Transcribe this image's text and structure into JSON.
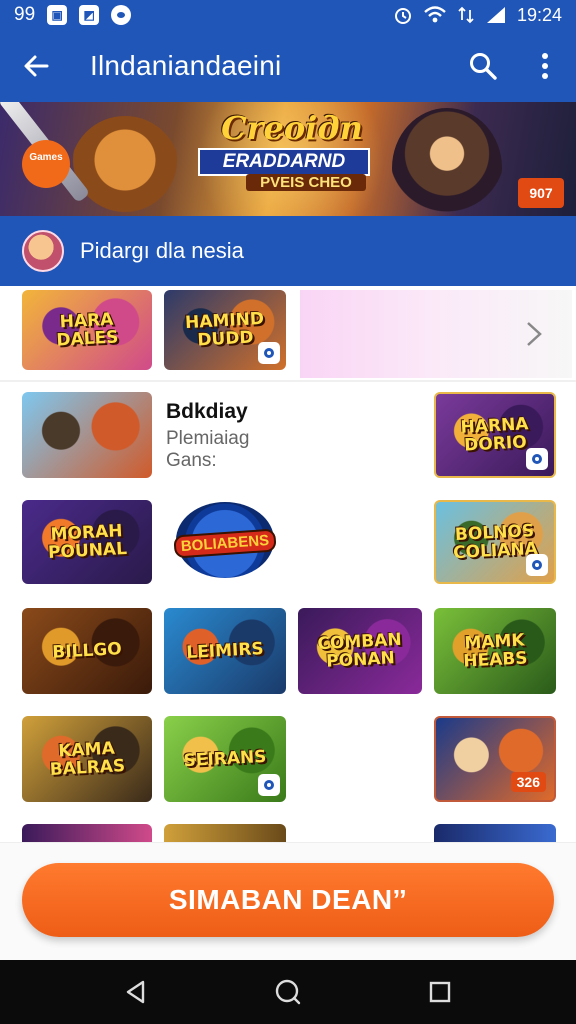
{
  "status_bar": {
    "left_text": "99",
    "time": "19:24",
    "icons": [
      "notification-icon",
      "image-icon",
      "record-icon"
    ],
    "right_icons": [
      "alarm-icon",
      "wifi-icon",
      "data-icon",
      "signal-icon",
      "battery-icon"
    ]
  },
  "app_bar": {
    "title": "Ilndaniandaeini",
    "back_icon": "arrow-left-icon",
    "search_icon": "search-icon",
    "more_icon": "more-vertical-icon"
  },
  "banner": {
    "title": "Crеоiдn",
    "subtitle": "ERADDARND",
    "tagline": "PVEIS CHEO",
    "left_badge": "Games",
    "right_badge": "907"
  },
  "section": {
    "title": "Pidargı dla nesia"
  },
  "tiles": [
    {
      "label": "HARA\nDALES",
      "colors": [
        "#f2b53a",
        "#d04a8a",
        "#7a2a8a"
      ]
    },
    {
      "label": "HAMIND\nDUDD",
      "colors": [
        "#2c3a6a",
        "#d0702a",
        "#1a2a4a"
      ]
    },
    {
      "label": "",
      "colors": [
        "#7ec8f0",
        "#d05a2a",
        "#4a3a2a"
      ]
    },
    {
      "label": "HARNA\nDORIO",
      "colors": [
        "#7a3a9a",
        "#3a1a5a",
        "#f0b03a"
      ]
    },
    {
      "label": "MORAH\nPOUNAL",
      "colors": [
        "#4a2a8a",
        "#2a1a4a",
        "#f07a2a"
      ]
    },
    {
      "label": "BOLNOS\nCOLIANA",
      "colors": [
        "#6ac0e0",
        "#e0a04a",
        "#3a6a2a"
      ]
    },
    {
      "label": "BILLGO",
      "colors": [
        "#8a4a1a",
        "#3a1a0a",
        "#e09a2a"
      ]
    },
    {
      "label": "LEIMIRS",
      "colors": [
        "#2a8ad0",
        "#1a3a6a",
        "#e0602a"
      ]
    },
    {
      "label": "COMBAN\nPONAN",
      "colors": [
        "#3a1a5a",
        "#8a2a9a",
        "#f0c03a"
      ]
    },
    {
      "label": "MAMK\nHEABS",
      "colors": [
        "#7ac03a",
        "#2a5a1a",
        "#e0a02a"
      ]
    },
    {
      "label": "KAMA\nBALRAS",
      "colors": [
        "#d0a03a",
        "#3a2a1a",
        "#e06a2a"
      ]
    },
    {
      "label": "SEIRANS",
      "colors": [
        "#8ad04a",
        "#3a7a1a",
        "#f0c04a"
      ]
    },
    {
      "label": "",
      "colors": [
        "#1a3a8a",
        "#e06a2a",
        "#f0d0a0"
      ]
    }
  ],
  "featured": {
    "title": "Bdkdiay",
    "subtitle_line1": "Plemiaiag",
    "subtitle_line2": "Gans:",
    "logo": "BOLIABENS"
  },
  "tile_badge_right": "326",
  "cta": {
    "label": "SIMABAN DEANˮ"
  },
  "nav": {
    "back": "back-triangle-icon",
    "home": "home-circle-icon",
    "recents": "recents-square-icon"
  },
  "colors": {
    "primary": "#1f56b8",
    "accent": "#ee5d16",
    "nav_bg": "#0b0b0b"
  }
}
